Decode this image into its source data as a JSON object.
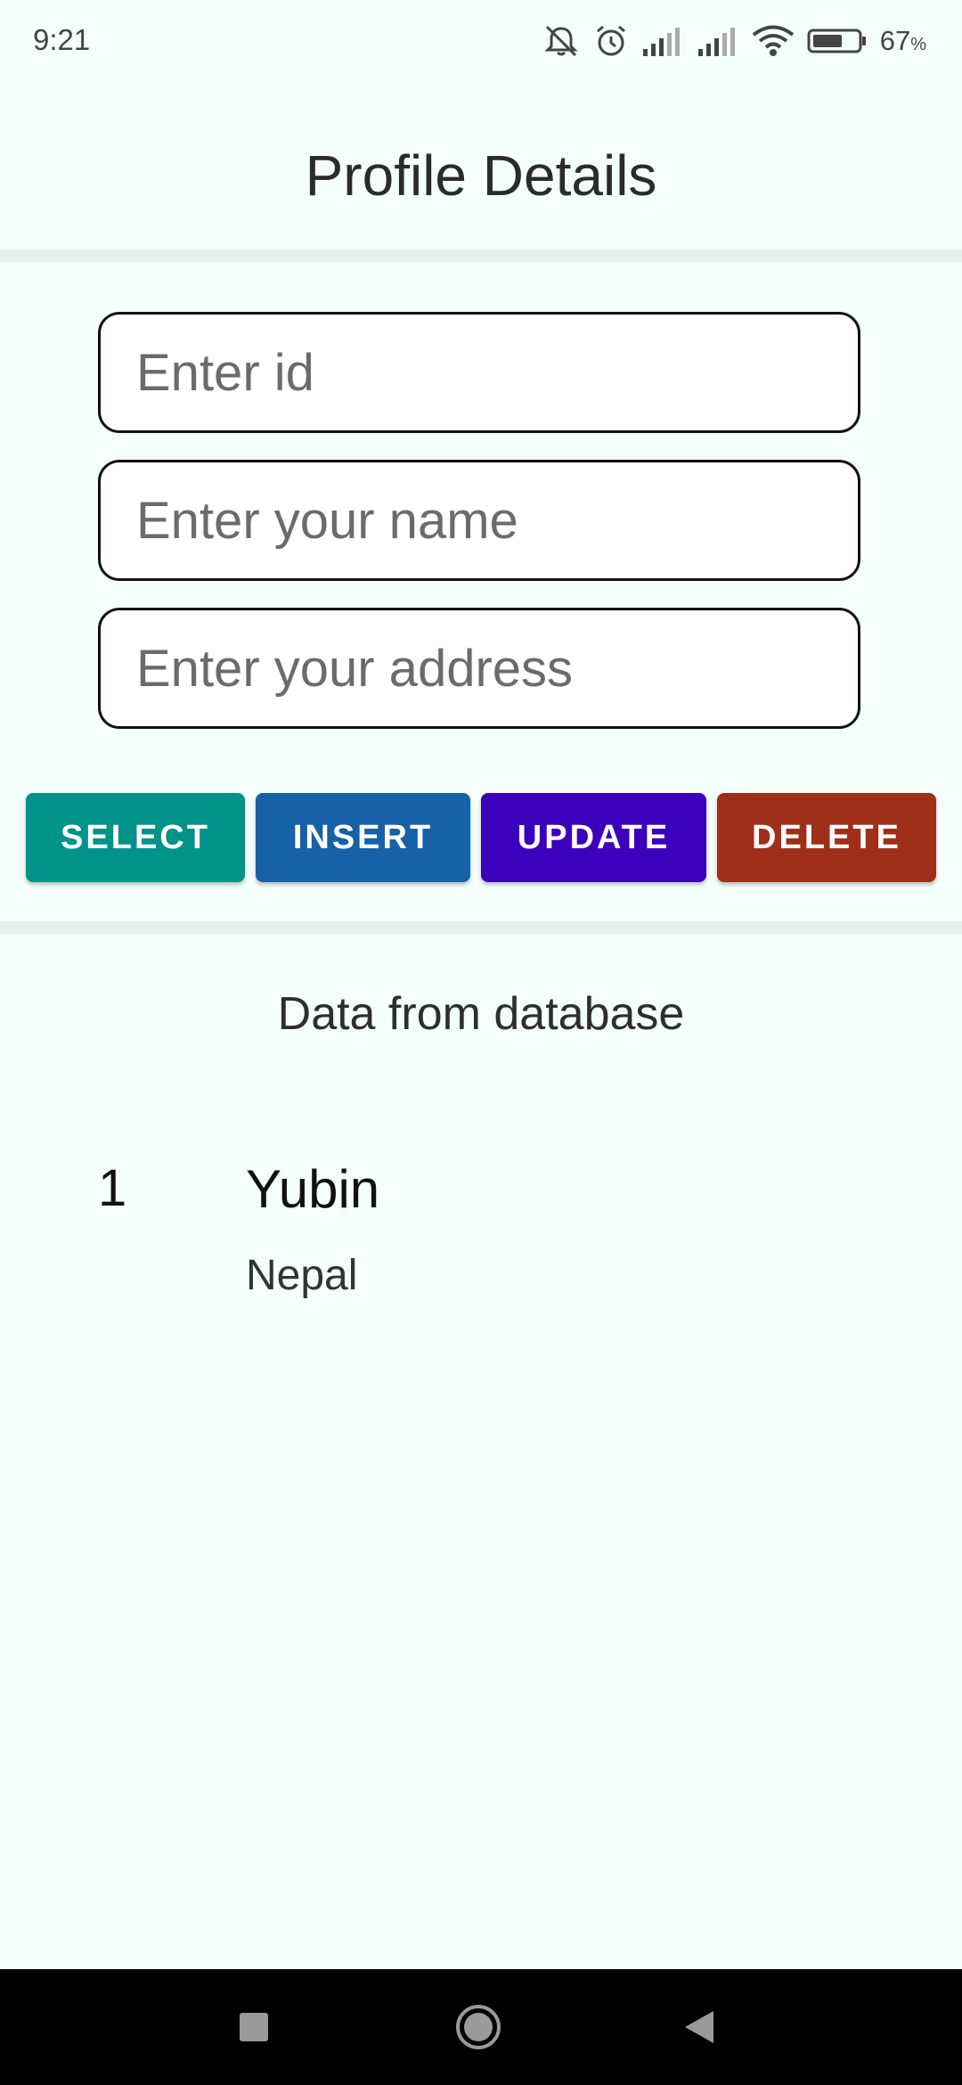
{
  "status_bar": {
    "time": "9:21",
    "battery_percent": "67",
    "battery_unit": "%",
    "icons": [
      "mute-icon",
      "alarm-icon",
      "signal-icon",
      "signal-icon",
      "wifi-icon",
      "battery-icon"
    ],
    "battery_level": 0.67
  },
  "header": {
    "title": "Profile Details"
  },
  "form": {
    "id_placeholder": "Enter id",
    "id_value": "",
    "name_placeholder": "Enter your name",
    "name_value": "",
    "address_placeholder": "Enter your address",
    "address_value": ""
  },
  "actions": {
    "select": {
      "label": "SELECT",
      "color": "#00938a"
    },
    "insert": {
      "label": "INSERT",
      "color": "#1661a8"
    },
    "update": {
      "label": "UPDATE",
      "color": "#3c00bd"
    },
    "delete": {
      "label": "DELETE",
      "color": "#a02f1a"
    }
  },
  "results": {
    "heading": "Data from database",
    "records": [
      {
        "id": "1",
        "name": "Yubin",
        "address": "Nepal"
      }
    ]
  },
  "nav_bar": {
    "icons": [
      "recents-icon",
      "home-icon",
      "back-icon"
    ]
  },
  "colors": {
    "background": "#f4fffb",
    "divider": "#e8eeeb"
  }
}
